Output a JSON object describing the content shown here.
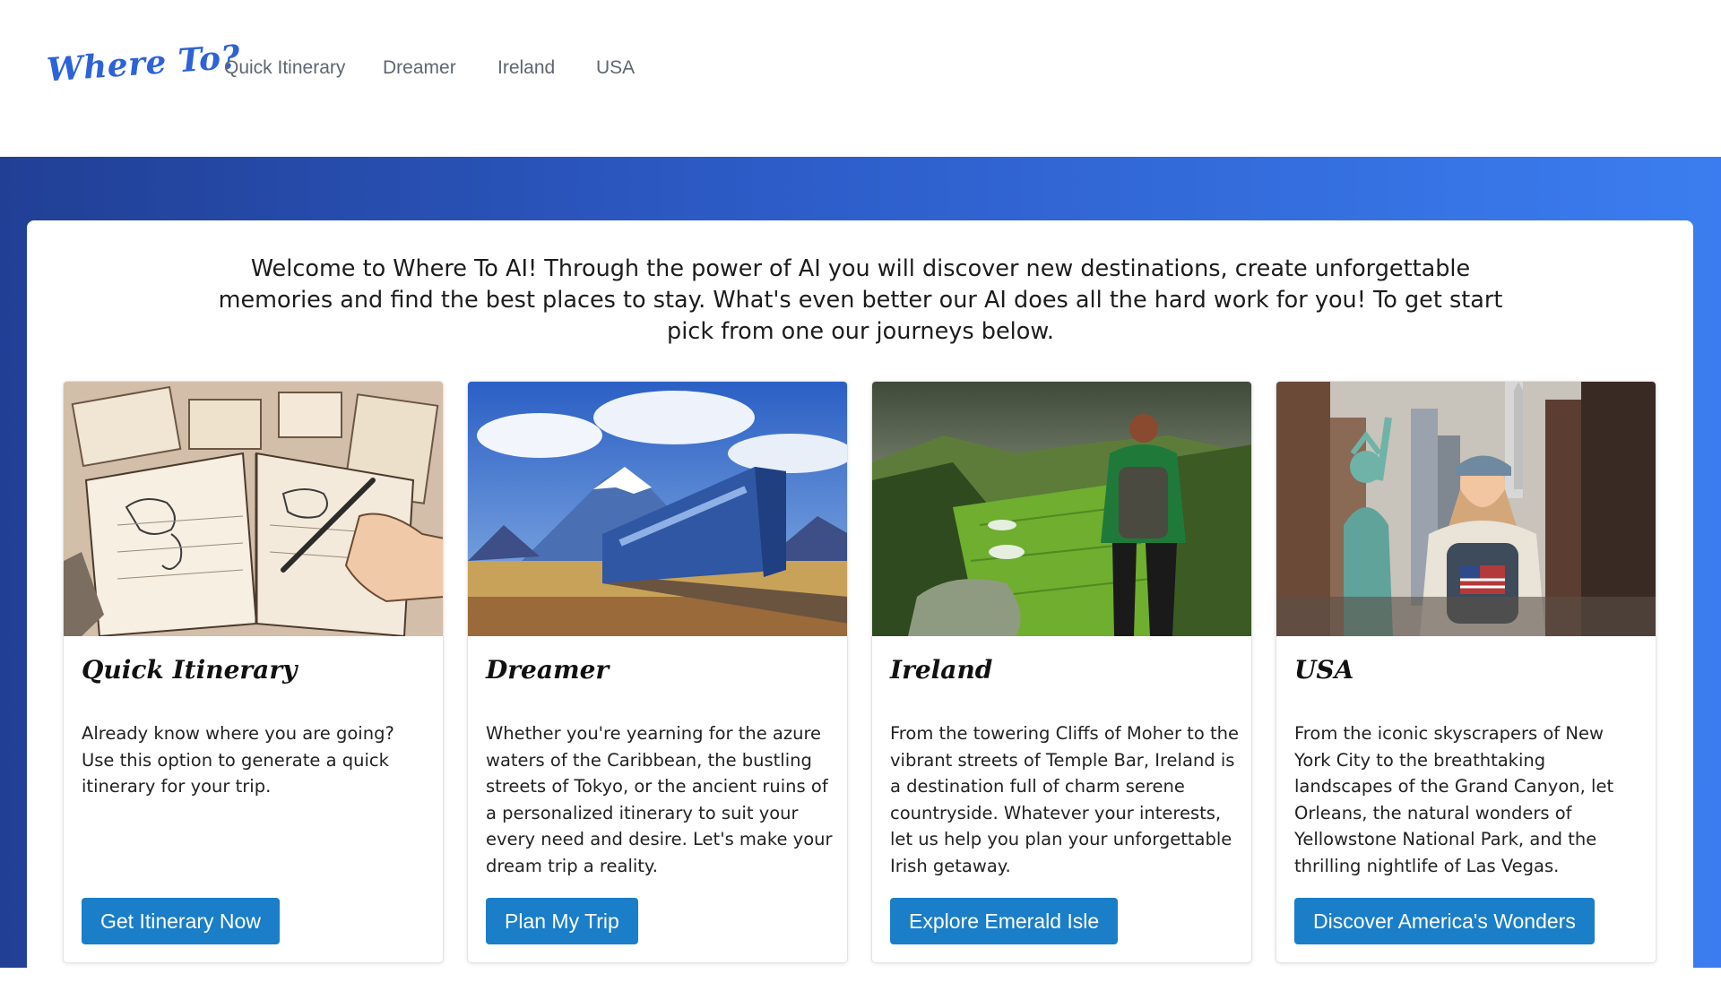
{
  "header": {
    "logo": "Where To?",
    "nav": [
      "Quick Itinerary",
      "Dreamer",
      "Ireland",
      "USA"
    ]
  },
  "intro": "Welcome to Where To AI! Through the power of AI you will discover new destinations, create unforgettable memories and find the best places to stay. What's even better our AI does all the hard work for you! To get start pick from one our journeys below.",
  "cards": [
    {
      "title": "Quick Itinerary",
      "text": "Already know where you are going? Use this option to generate a quick itinerary for your trip.",
      "button": "Get Itinerary Now",
      "image_icon": "map-journal-illustration"
    },
    {
      "title": "Dreamer",
      "text": "Whether you're yearning for the azure waters of the Caribbean, the bustling streets of Tokyo, or the ancient ruins of a personalized itinerary to suit your every need and desire. Let's make your dream trip a reality.",
      "button": "Plan My Trip",
      "image_icon": "train-mountain-illustration"
    },
    {
      "title": "Ireland",
      "text": "From the towering Cliffs of Moher to the vibrant streets of Temple Bar, Ireland is a destination full of charm serene countryside. Whatever your interests, let us help you plan your unforgettable Irish getaway.",
      "button": "Explore Emerald Isle",
      "image_icon": "ireland-hiker-illustration"
    },
    {
      "title": "USA",
      "text": "From the iconic skyscrapers of New York City to the breathtaking landscapes of the Grand Canyon, let Orleans, the natural wonders of Yellowstone National Park, and the thrilling nightlife of Las Vegas.",
      "button": "Discover America's Wonders",
      "image_icon": "new-york-traveler-illustration"
    }
  ],
  "colors": {
    "brand": "#2d63d8",
    "button": "#1a7ec8",
    "hero_start": "#213f95",
    "hero_end": "#3b7df0",
    "nav_text": "#5f6670"
  }
}
